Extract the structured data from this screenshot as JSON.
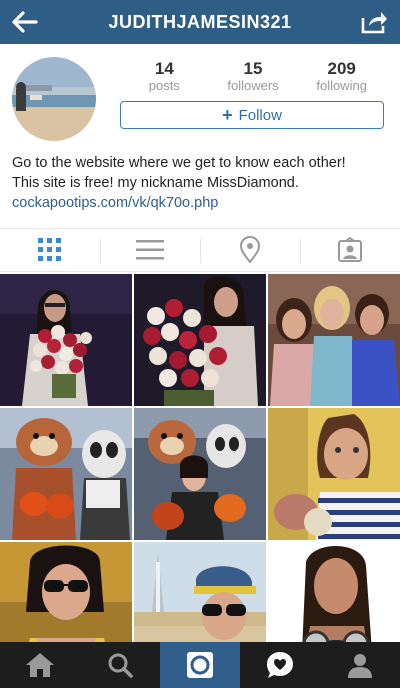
{
  "header": {
    "username": "JUDITHJAMESIN321",
    "background_color": "#2e5e86"
  },
  "profile": {
    "stats": [
      {
        "count": "14",
        "label": "posts"
      },
      {
        "count": "15",
        "label": "followers"
      },
      {
        "count": "209",
        "label": "following"
      }
    ],
    "follow_button": {
      "icon": "+",
      "label": "Follow"
    },
    "bio_lines": [
      "Go to the website where we get to know each other!",
      "This site is free! my nickname MissDiamond."
    ],
    "link": "cockapootips.com/vk/qk70o.php"
  },
  "tabs": [
    "grid-view",
    "list-view",
    "location",
    "tagged"
  ],
  "grid_photos": [
    "woman-with-rose-bouquet",
    "rose-bouquet-closeup",
    "three-women-group",
    "mascot-costumes",
    "woman-with-mascots",
    "woman-selfie-striped",
    "woman-sunglasses-selfie",
    "woman-cap-burj-al-arab",
    "woman-headphones"
  ],
  "bottom_nav": [
    "home",
    "explore",
    "camera",
    "activity",
    "profile"
  ],
  "colors": {
    "accent": "#3a7bbd",
    "link": "#2f5f92",
    "active_tab": "#3a89d4",
    "bottom_bar": "#1d1d1d",
    "bottom_active": "#2f5f8a"
  }
}
